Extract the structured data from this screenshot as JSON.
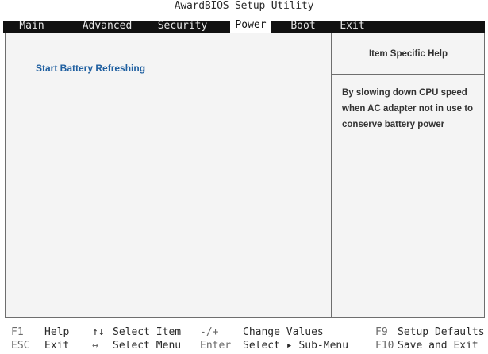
{
  "title": "AwardBIOS Setup Utility",
  "menu": [
    {
      "label": "Main",
      "active": false
    },
    {
      "label": "Advanced",
      "active": false
    },
    {
      "label": "Security",
      "active": false
    },
    {
      "label": "Power",
      "active": true
    },
    {
      "label": "Boot",
      "active": false
    },
    {
      "label": "Exit",
      "active": false
    }
  ],
  "left_pane": {
    "entries": [
      "Start Battery Refreshing"
    ]
  },
  "help": {
    "header": "Item Specific Help",
    "text": "By slowing down CPU speed when AC adapter not in use to conserve battery power"
  },
  "legend": {
    "row1": [
      {
        "key": "F1",
        "desc": "Help"
      },
      {
        "key": "↑↓",
        "desc": "Select Item"
      },
      {
        "key": "-/+",
        "desc": "Change Values"
      },
      {
        "key": "F9",
        "desc": "Setup Defaults"
      }
    ],
    "row2": [
      {
        "key": "ESC",
        "desc": "Exit"
      },
      {
        "key": "↔",
        "desc": "Select Menu"
      },
      {
        "key": "Enter",
        "desc": "Select ▸ Sub-Menu"
      },
      {
        "key": "F10",
        "desc": "Save and Exit"
      }
    ]
  }
}
